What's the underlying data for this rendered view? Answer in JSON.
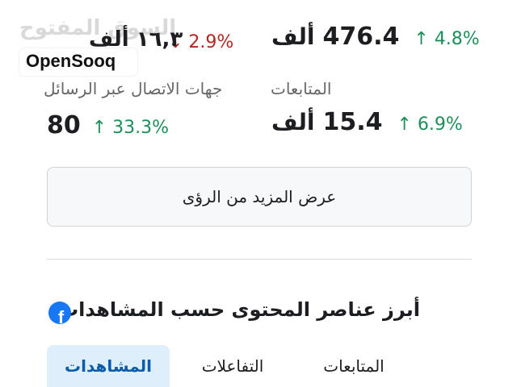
{
  "watermark": {
    "arabic": "السوق المفتوح",
    "english": "OpenSooq"
  },
  "metrics": {
    "top_left": {
      "value": "١٦,٣ ألف",
      "change": "↓ 2.9%",
      "direction": "down"
    },
    "top_right": {
      "value": "476.4",
      "unit": "ألف",
      "change": "↑ 4.8%",
      "direction": "up"
    },
    "messaging": {
      "label": "جهات الاتصال عبر الرسائل",
      "value": "80",
      "change": "↑ 33.3%",
      "direction": "up"
    },
    "follows": {
      "label": "المتابعات",
      "value": "15.4",
      "unit": "ألف",
      "change": "↑ 6.9%",
      "direction": "up"
    }
  },
  "more_insights_button": "عرض المزيد من الرؤى",
  "section": {
    "title": "أبرز عناصر المحتوى حسب المشاهدات",
    "icon": "facebook-icon"
  },
  "tabs": [
    {
      "label": "المشاهدات",
      "active": true
    },
    {
      "label": "التفاعلات",
      "active": false
    },
    {
      "label": "المتابعات",
      "active": false
    }
  ],
  "colors": {
    "up": "#1e8e5a",
    "down": "#b3261e",
    "accent": "#1877f2",
    "active_tab_bg": "#dfeefb"
  }
}
